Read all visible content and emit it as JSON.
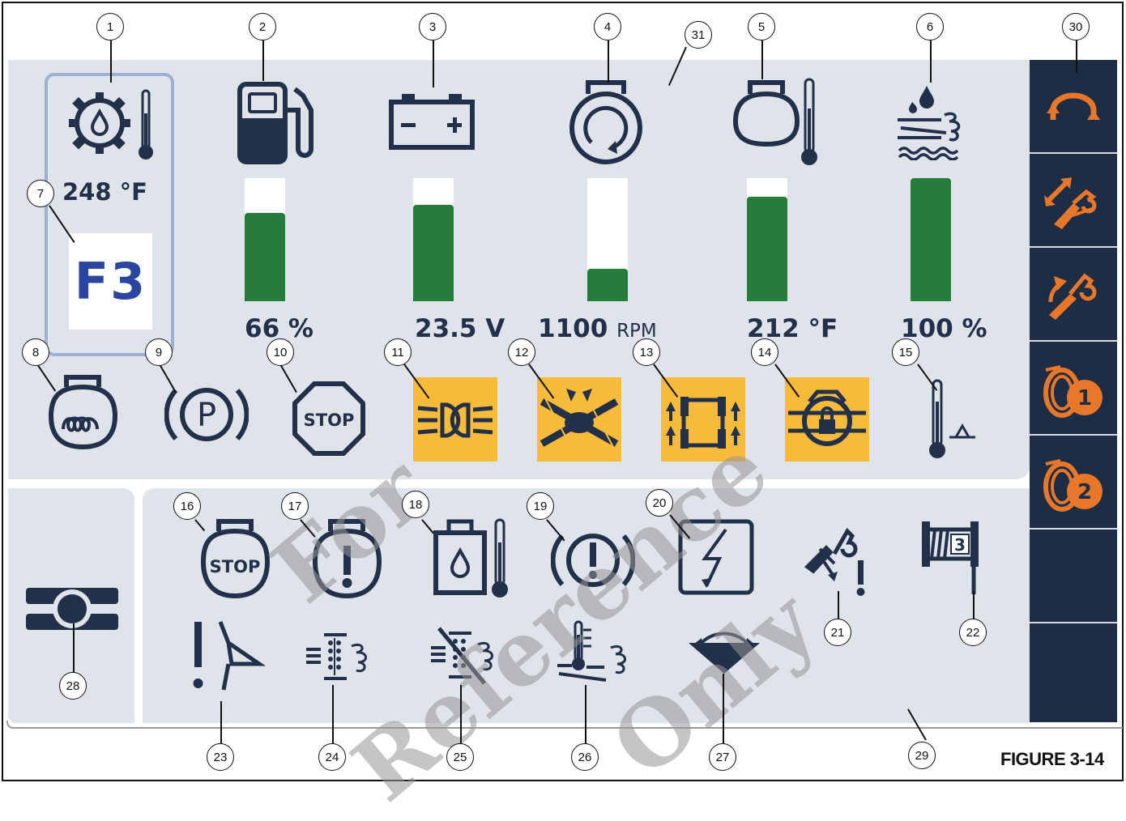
{
  "gauges": {
    "trans_temp": "248 °F",
    "fuel": "66 %",
    "battery": "23.5 V",
    "engine_speed_value": "1100",
    "engine_speed_unit": "RPM",
    "coolant_temp": "212 °F",
    "def_level": "100 %"
  },
  "bar_levels": {
    "fuel": 0.72,
    "battery": 0.78,
    "engine_speed": 0.26,
    "coolant": 0.85,
    "def": 1.0
  },
  "gear": "F3",
  "callouts": {
    "c1": "1",
    "c2": "2",
    "c3": "3",
    "c4": "4",
    "c5": "5",
    "c6": "6",
    "c7": "7",
    "c8": "8",
    "c9": "9",
    "c10": "10",
    "c11": "11",
    "c12": "12",
    "c13": "13",
    "c14": "14",
    "c15": "15",
    "c16": "16",
    "c17": "17",
    "c18": "18",
    "c19": "19",
    "c20": "20",
    "c21": "21",
    "c22": "22",
    "c23": "23",
    "c24": "24",
    "c25": "25",
    "c26": "26",
    "c27": "27",
    "c28": "28",
    "c29": "29",
    "c30": "30",
    "c31": "31"
  },
  "figure_label": "FIGURE 3-14",
  "watermark": [
    "For",
    "Reference",
    "Only"
  ],
  "icon_text": {
    "stop": "STOP",
    "park": "P",
    "winch3": "3",
    "drum1": "1",
    "drum2": "2"
  },
  "colors": {
    "panel": "#dfe3ea",
    "dark_navy": "#1c2d45",
    "icon": "#22304a",
    "bar_green": "#267c3b",
    "amber": "#f6bb3a",
    "orange": "#e8772a",
    "gear_blue": "#2a46a0"
  }
}
